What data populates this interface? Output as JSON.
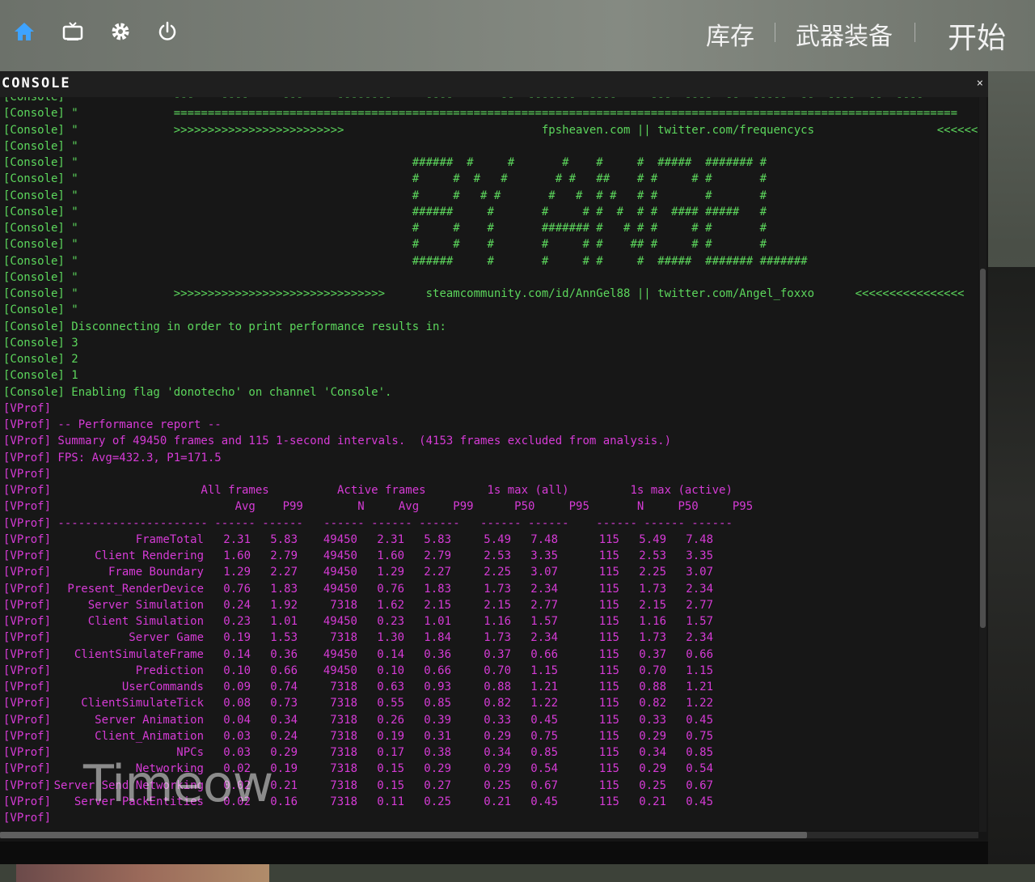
{
  "topbar": {
    "icons": [
      "home-icon",
      "tv-icon",
      "gear-icon",
      "power-icon"
    ],
    "nav_inventory": "库存",
    "nav_loadout": "武器装备",
    "nav_start": "开始"
  },
  "console": {
    "title": "CONSOLE",
    "close": "×",
    "watermark": "Timeow",
    "lines": [
      "[Console] \"              ===================================================================================================================",
      "[Console] \"              >>>>>>>>>>>>>>>>>>>>>>>>>                             fpsheaven.com || twitter.com/frequencycs                  <<<<<<<<<<<<",
      "[Console] \"",
      "[Console] \"                                                 ######  #     #       #    #     #  #####  ####### #",
      "[Console] \"                                                 #     #  #   #       # #   ##    # #     # #       #",
      "[Console] \"                                                 #     #   # #       #   #  # #   # #       #       #",
      "[Console] \"                                                 ######     #       #     # #  #  # #  #### #####   #",
      "[Console] \"                                                 #     #    #       ####### #   # # #     # #       #",
      "[Console] \"                                                 #     #    #       #     # #    ## #     # #       #",
      "[Console] \"                                                 ######     #       #     # #     #  #####  ####### #######",
      "[Console] \"",
      "[Console] \"              >>>>>>>>>>>>>>>>>>>>>>>>>>>>>>>      steamcommunity.com/id/AnnGel88 || twitter.com/Angel_foxxo      <<<<<<<<<<<<<<<<",
      "[Console] \"",
      "[Console] Disconnecting in order to print performance results in:",
      "[Console] 3",
      "[Console] 2",
      "[Console] 1",
      "[Console] Enabling flag 'donotecho' on channel 'Console'."
    ],
    "vprof_lines": [
      "[VProf]",
      "[VProf] -- Performance report --",
      "[VProf] Summary of 49450 frames and 115 1-second intervals.  (4153 frames excluded from analysis.)",
      "[VProf] FPS: Avg=432.3, P1=171.5",
      "[VProf]",
      "[VProf]                      All frames          Active frames         1s max (all)         1s max (active)",
      "[VProf]                           Avg    P99        N     Avg     P99      P50     P95       N     P50     P95",
      "[VProf] ---------------------- ------ ------   ------ ------ ------   ------ ------    ------ ------ ------"
    ],
    "table": [
      [
        "FrameTotal",
        "2.31",
        "5.83",
        "49450",
        "2.31",
        "5.83",
        "5.49",
        "7.48",
        "115",
        "5.49",
        "7.48"
      ],
      [
        "Client Rendering",
        "1.60",
        "2.79",
        "49450",
        "1.60",
        "2.79",
        "2.53",
        "3.35",
        "115",
        "2.53",
        "3.35"
      ],
      [
        "Frame Boundary",
        "1.29",
        "2.27",
        "49450",
        "1.29",
        "2.27",
        "2.25",
        "3.07",
        "115",
        "2.25",
        "3.07"
      ],
      [
        "Present_RenderDevice",
        "0.76",
        "1.83",
        "49450",
        "0.76",
        "1.83",
        "1.73",
        "2.34",
        "115",
        "1.73",
        "2.34"
      ],
      [
        "Server Simulation",
        "0.24",
        "1.92",
        "7318",
        "1.62",
        "2.15",
        "2.15",
        "2.77",
        "115",
        "2.15",
        "2.77"
      ],
      [
        "Client Simulation",
        "0.23",
        "1.01",
        "49450",
        "0.23",
        "1.01",
        "1.16",
        "1.57",
        "115",
        "1.16",
        "1.57"
      ],
      [
        "Server Game",
        "0.19",
        "1.53",
        "7318",
        "1.30",
        "1.84",
        "1.73",
        "2.34",
        "115",
        "1.73",
        "2.34"
      ],
      [
        "ClientSimulateFrame",
        "0.14",
        "0.36",
        "49450",
        "0.14",
        "0.36",
        "0.37",
        "0.66",
        "115",
        "0.37",
        "0.66"
      ],
      [
        "Prediction",
        "0.10",
        "0.66",
        "49450",
        "0.10",
        "0.66",
        "0.70",
        "1.15",
        "115",
        "0.70",
        "1.15"
      ],
      [
        "UserCommands",
        "0.09",
        "0.74",
        "7318",
        "0.63",
        "0.93",
        "0.88",
        "1.21",
        "115",
        "0.88",
        "1.21"
      ],
      [
        "ClientSimulateTick",
        "0.08",
        "0.73",
        "7318",
        "0.55",
        "0.85",
        "0.82",
        "1.22",
        "115",
        "0.82",
        "1.22"
      ],
      [
        "Server Animation",
        "0.04",
        "0.34",
        "7318",
        "0.26",
        "0.39",
        "0.33",
        "0.45",
        "115",
        "0.33",
        "0.45"
      ],
      [
        "Client_Animation",
        "0.03",
        "0.24",
        "7318",
        "0.19",
        "0.31",
        "0.29",
        "0.75",
        "115",
        "0.29",
        "0.75"
      ],
      [
        "NPCs",
        "0.03",
        "0.29",
        "7318",
        "0.17",
        "0.38",
        "0.34",
        "0.85",
        "115",
        "0.34",
        "0.85"
      ],
      [
        "Networking",
        "0.02",
        "0.19",
        "7318",
        "0.15",
        "0.29",
        "0.29",
        "0.54",
        "115",
        "0.29",
        "0.54"
      ],
      [
        "Server Send Networking",
        "0.02",
        "0.21",
        "7318",
        "0.15",
        "0.27",
        "0.25",
        "0.67",
        "115",
        "0.25",
        "0.67"
      ],
      [
        "Server PackEntities",
        "0.02",
        "0.16",
        "7318",
        "0.11",
        "0.25",
        "0.21",
        "0.45",
        "115",
        "0.21",
        "0.45"
      ]
    ],
    "row_prefix": "[VProf]",
    "last_line": "[VProf]"
  }
}
